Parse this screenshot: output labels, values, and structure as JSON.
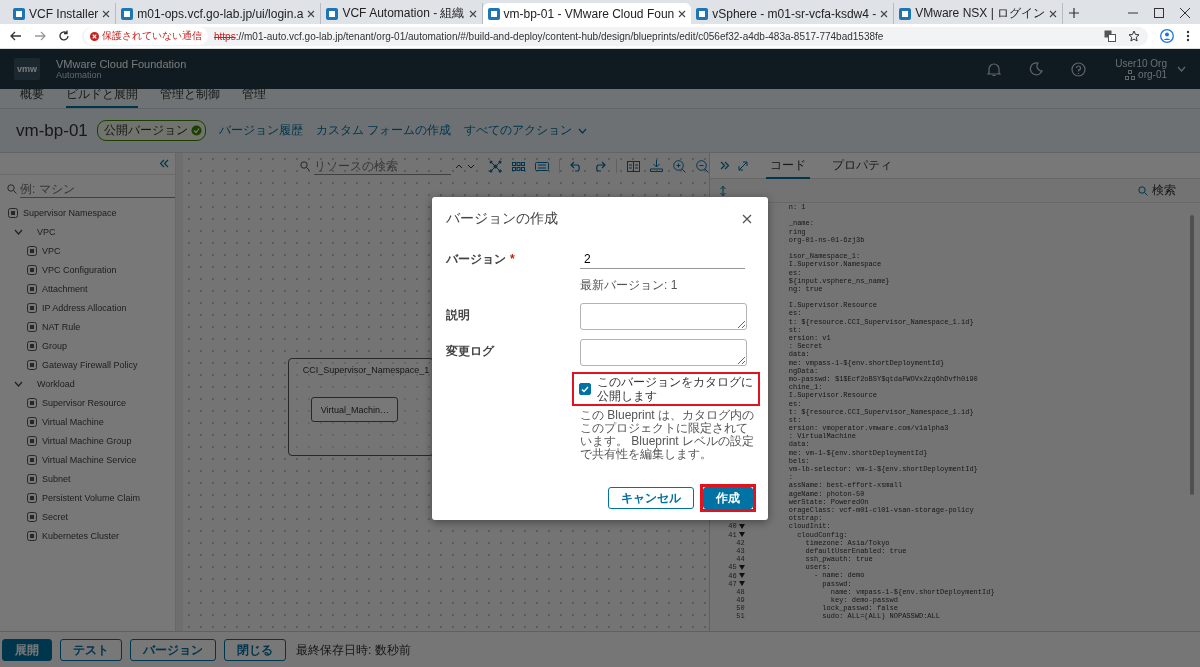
{
  "browser": {
    "tabs": [
      {
        "title": "VCF Installer",
        "selected": false
      },
      {
        "title": "m01-ops.vcf.go-lab.jp/ui/login.a",
        "selected": false
      },
      {
        "title": "VCF Automation - 組織",
        "selected": false
      },
      {
        "title": "vm-bp-01 - VMware Cloud Foun",
        "selected": true
      },
      {
        "title": "vSphere - m01-sr-vcfa-ksdw4 -",
        "selected": false
      },
      {
        "title": "VMware NSX | ログイン",
        "selected": false
      }
    ],
    "security_chip": "保護されていない通信",
    "url_scheme": "https",
    "url_rest": "://m01-auto.vcf.go-lab.jp/tenant/org-01/automation/#/build-and-deploy/content-hub/design/blueprints/edit/c056ef32-a4db-483a-8517-774bad1538fe"
  },
  "app_header": {
    "logo": "vmw",
    "title": "VMware Cloud Foundation",
    "subtitle": "Automation",
    "user": "User10 Org",
    "org": "org-01"
  },
  "nav_tabs": [
    {
      "label": "概要",
      "selected": false
    },
    {
      "label": "ビルドと展開",
      "selected": true
    },
    {
      "label": "管理と制御",
      "selected": false
    },
    {
      "label": "管理",
      "selected": false
    }
  ],
  "blueprint": {
    "name": "vm-bp-01",
    "badge": "公開バージョン",
    "actions": [
      "バージョン履歴",
      "カスタム フォームの作成",
      "すべてのアクション"
    ]
  },
  "resource_palette": {
    "search": {
      "placeholder": "例: マシン"
    },
    "tree": [
      {
        "kind": "resource",
        "label": "Supervisor Namespace"
      },
      {
        "kind": "category",
        "label": "VPC",
        "expanded": true,
        "children": [
          {
            "kind": "resource",
            "label": "VPC"
          },
          {
            "kind": "resource",
            "label": "VPC Configuration"
          },
          {
            "kind": "resource",
            "label": "Attachment"
          },
          {
            "kind": "resource",
            "label": "IP Address Allocation"
          },
          {
            "kind": "resource",
            "label": "NAT Rule"
          },
          {
            "kind": "resource",
            "label": "Group"
          },
          {
            "kind": "resource",
            "label": "Gateway Firewall Policy"
          }
        ]
      },
      {
        "kind": "category",
        "label": "Workload",
        "expanded": true,
        "children": [
          {
            "kind": "resource",
            "label": "Supervisor Resource"
          },
          {
            "kind": "resource",
            "label": "Virtual Machine"
          },
          {
            "kind": "resource",
            "label": "Virtual Machine Group"
          },
          {
            "kind": "resource",
            "label": "Virtual Machine Service"
          },
          {
            "kind": "resource",
            "label": "Subnet"
          },
          {
            "kind": "resource",
            "label": "Persistent Volume Claim"
          },
          {
            "kind": "resource",
            "label": "Secret"
          },
          {
            "kind": "resource",
            "label": "Kubernetes Cluster"
          }
        ]
      }
    ]
  },
  "canvas": {
    "search": {
      "placeholder": "リソースの検索"
    },
    "group_node": {
      "title": "CCI_Supervisor_Namespace_1",
      "children": [
        {
          "label": "Virtual_Machin…"
        }
      ]
    }
  },
  "editor": {
    "tabs": [
      {
        "label": "コード",
        "selected": true
      },
      {
        "label": "プロパティ",
        "selected": false
      }
    ],
    "search_label": "検索",
    "lines": [
      {
        "kind": "cut",
        "text": "n: 1"
      },
      {
        "kind": "blank"
      },
      {
        "kind": "cut",
        "text": "_name:"
      },
      {
        "kind": "cut",
        "text": "ring"
      },
      {
        "kind": "cut",
        "text": "org-01-ns-01-6zj3b"
      },
      {
        "kind": "blank"
      },
      {
        "kind": "cut",
        "text": "isor_Namespace_1:"
      },
      {
        "kind": "cut",
        "text": "I.Supervisor.Namespace"
      },
      {
        "kind": "cut",
        "text": "es:"
      },
      {
        "kind": "cut",
        "text": "${input.vsphere_ns_name}"
      },
      {
        "kind": "cut",
        "text": "ng: true"
      },
      {
        "kind": "blank"
      },
      {
        "kind": "cut",
        "text": "I.Supervisor.Resource"
      },
      {
        "kind": "cut",
        "text": "es:"
      },
      {
        "kind": "cut",
        "text": "t: ${resource.CCI_Supervisor_Namespace_1.id}"
      },
      {
        "kind": "cut",
        "text": "st:"
      },
      {
        "kind": "cut",
        "text": "ersion: v1"
      },
      {
        "kind": "cut",
        "text": ": Secret"
      },
      {
        "kind": "cut",
        "text": "data:"
      },
      {
        "kind": "cut",
        "text": "me: vmpass-1-${env.shortDeploymentId}"
      },
      {
        "kind": "cut",
        "text": "ngData:"
      },
      {
        "kind": "cut",
        "text": "mo-passwd: $1$Ecf2oBSY$qtdaFWOVx2zq6hDvfh0i90"
      },
      {
        "kind": "cut",
        "text": "chine_1:"
      },
      {
        "kind": "cut",
        "text": "I.Supervisor.Resource"
      },
      {
        "kind": "cut",
        "text": "es:"
      },
      {
        "kind": "cut",
        "text": "t: ${resource.CCI_Supervisor_Namespace_1.id}"
      },
      {
        "kind": "cut",
        "text": "st:"
      },
      {
        "kind": "cut",
        "text": "ersion: vmoperator.vmware.com/v1alpha3"
      },
      {
        "kind": "cut",
        "text": ": VirtualMachine"
      },
      {
        "kind": "cut",
        "text": "data:"
      },
      {
        "kind": "cut",
        "text": "me: vm-1-${env.shortDeploymentId}"
      },
      {
        "kind": "cut",
        "text": "bels:"
      },
      {
        "kind": "cut",
        "text": "vm-lb-selector: vm-1-${env.shortDeploymentId}"
      },
      {
        "kind": "cut",
        "text": ":"
      },
      {
        "kind": "cut",
        "text": "assName: best-effort-xsmall"
      },
      {
        "kind": "cut",
        "text": "ageName: photon-50"
      },
      {
        "kind": "cut",
        "text": "werState: PoweredOn"
      },
      {
        "kind": "cut",
        "text": "orageClass: vcf-m01-cl01-vsan-storage-policy"
      },
      {
        "kind": "cut",
        "text": "otstrap:"
      },
      {
        "kind": "numbered",
        "number": "40",
        "foldable": true,
        "text": "cloudInit:"
      },
      {
        "kind": "numbered",
        "number": "41",
        "foldable": true,
        "text": "  cloudConfig:"
      },
      {
        "kind": "numbered",
        "number": "42",
        "foldable": false,
        "text": "    timezone: Asia/Tokyo"
      },
      {
        "kind": "numbered",
        "number": "43",
        "foldable": false,
        "text": "    defaultUserEnabled: true"
      },
      {
        "kind": "numbered",
        "number": "44",
        "foldable": false,
        "text": "    ssh_pwauth: true"
      },
      {
        "kind": "numbered",
        "number": "45",
        "foldable": true,
        "text": "    users:"
      },
      {
        "kind": "numbered",
        "number": "46",
        "foldable": true,
        "text": "      - name: demo"
      },
      {
        "kind": "numbered",
        "number": "47",
        "foldable": true,
        "text": "        passwd:"
      },
      {
        "kind": "numbered",
        "number": "48",
        "foldable": false,
        "text": "          name: vmpass-1-${env.shortDeploymentId}"
      },
      {
        "kind": "numbered",
        "number": "49",
        "foldable": false,
        "text": "          key: demo-passwd"
      },
      {
        "kind": "numbered",
        "number": "50",
        "foldable": false,
        "text": "        lock_passwd: false"
      },
      {
        "kind": "numbered",
        "number": "51",
        "foldable": false,
        "text": "        sudo: ALL=(ALL) NOPASSWD:ALL"
      }
    ]
  },
  "dialog": {
    "title": "バージョンの作成",
    "fields": [
      {
        "kind": "input",
        "label": "バージョン",
        "required_mark": "*",
        "value": "2",
        "hint": "最新バージョン: 1"
      },
      {
        "kind": "textarea",
        "label": "説明"
      },
      {
        "kind": "textarea",
        "label": "変更ログ"
      }
    ],
    "publish": {
      "label": "このバージョンをカタログに公開します",
      "checked": true,
      "highlighted": true
    },
    "help": "この Blueprint は、カタログ内のこのプロジェクトに限定されています。 Blueprint レベルの設定で共有性を編集します。",
    "buttons": [
      {
        "label": "キャンセル",
        "kind": "secondary",
        "highlighted": false
      },
      {
        "label": "作成",
        "kind": "primary",
        "highlighted": true
      }
    ]
  },
  "footer": {
    "buttons": [
      {
        "label": "展開",
        "kind": "primary"
      },
      {
        "label": "テスト",
        "kind": "secondary"
      },
      {
        "label": "バージョン",
        "kind": "secondary"
      },
      {
        "label": "閉じる",
        "kind": "secondary"
      }
    ],
    "saved": "最終保存日時: 数秒前"
  }
}
